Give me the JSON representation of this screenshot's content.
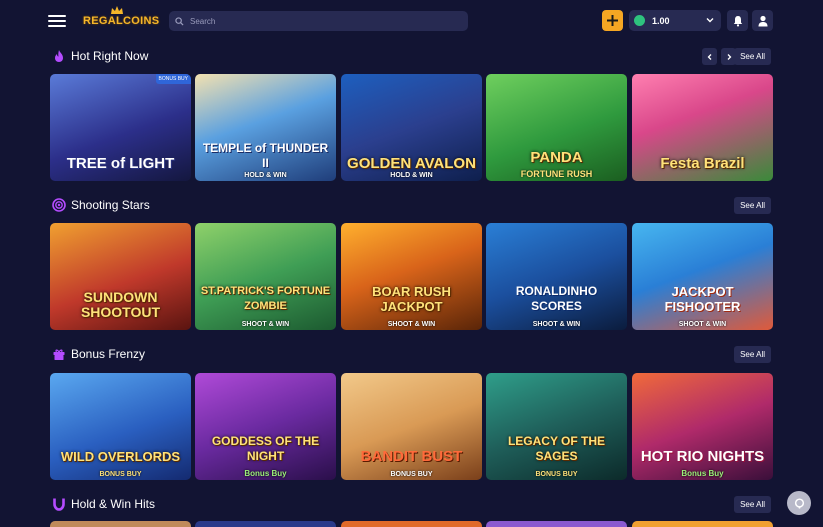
{
  "header": {
    "logo_text": "REGALCOINS",
    "search_placeholder": "Search",
    "balance": "1.00",
    "menu_icon": "hamburger-icon",
    "add_icon": "plus-icon",
    "bell_icon": "bell-icon",
    "user_icon": "user-icon",
    "accent_color": "#f5a623"
  },
  "sections": [
    {
      "title": "Hot Right Now",
      "icon": "flame-icon",
      "see_all": "See All",
      "cards": [
        {
          "title": "TREE of LIGHT",
          "subtitle": "",
          "badge": "BONUS BUY"
        },
        {
          "title": "TEMPLE of THUNDER II",
          "subtitle": "HOLD & WIN"
        },
        {
          "title": "GOLDEN AVALON",
          "subtitle": "HOLD & WIN"
        },
        {
          "title": "PANDA",
          "subtitle": "FORTUNE RUSH"
        },
        {
          "title": "Festa Brazil",
          "subtitle": ""
        }
      ]
    },
    {
      "title": "Shooting Stars",
      "icon": "target-icon",
      "see_all": "See All",
      "cards": [
        {
          "title": "SUNDOWN SHOOTOUT",
          "subtitle": ""
        },
        {
          "title": "ST.PATRICK'S FORTUNE ZOMBIE",
          "subtitle": "SHOOT & WIN"
        },
        {
          "title": "BOAR RUSH JACKPOT",
          "subtitle": "SHOOT & WIN"
        },
        {
          "title": "RONALDINHO SCORES",
          "subtitle": "SHOOT & WIN"
        },
        {
          "title": "JACKPOT FISHOOTER",
          "subtitle": "SHOOT & WIN"
        }
      ]
    },
    {
      "title": "Bonus Frenzy",
      "icon": "gift-icon",
      "see_all": "See All",
      "cards": [
        {
          "title": "WILD OVERLORDS",
          "subtitle": "BONUS BUY"
        },
        {
          "title": "GODDESS OF THE NIGHT",
          "subtitle": "Bonus Buy"
        },
        {
          "title": "BANDIT BUST",
          "subtitle": "BONUS BUY"
        },
        {
          "title": "LEGACY OF THE SAGES",
          "subtitle": "BONUS BUY"
        },
        {
          "title": "HOT RIO NIGHTS",
          "subtitle": "Bonus Buy"
        }
      ]
    },
    {
      "title": "Hold & Win Hits",
      "icon": "magnet-icon",
      "see_all": "See All",
      "cards": []
    }
  ]
}
